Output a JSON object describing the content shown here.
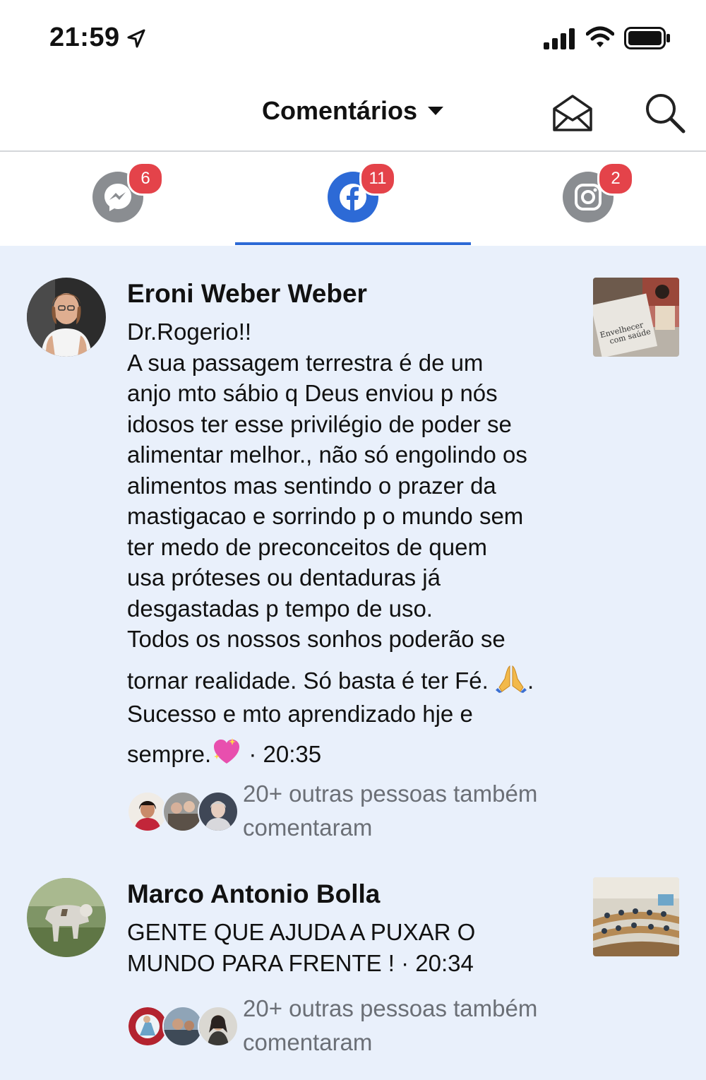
{
  "status": {
    "time": "21:59"
  },
  "header": {
    "title": "Comentários"
  },
  "tabs": [
    {
      "name": "messenger",
      "badge": "6",
      "color": "#8a8d91"
    },
    {
      "name": "facebook",
      "badge": "11",
      "color": "#2d6ad6",
      "active": true
    },
    {
      "name": "instagram",
      "badge": "2",
      "color": "#8a8d91"
    }
  ],
  "comments": [
    {
      "author": "Eroni Weber Weber",
      "lines": [
        "Dr.Rogerio!!",
        "A sua passagem terrestra é de um",
        "anjo mto sábio q Deus enviou p nós",
        "idosos ter esse privilégio de poder se",
        "alimentar melhor., não só engolindo os",
        "alimentos mas sentindo o prazer da",
        "mastigacao e sorrindo p o mundo sem",
        "ter medo de preconceitos de quem",
        "usa próteses ou dentaduras já",
        "desgastadas p tempo de uso.",
        "Todos os nossos sonhos poderão se"
      ],
      "line12": "tornar realidade. Só basta é ter Fé.",
      "line12_end": ".",
      "line13": "Sucesso e mto aprendizado hje e",
      "line14": "sempre.",
      "time": " · 20:35",
      "others_line1": "20+ outras pessoas também",
      "others_line2": "comentaram"
    },
    {
      "author": "Marco Antonio Bolla",
      "line1": "GENTE QUE AJUDA A PUXAR O",
      "line2": "MUNDO PARA FRENTE  ! · 20:34",
      "others_line1": "20+ outras pessoas também",
      "others_line2": "comentaram"
    }
  ]
}
